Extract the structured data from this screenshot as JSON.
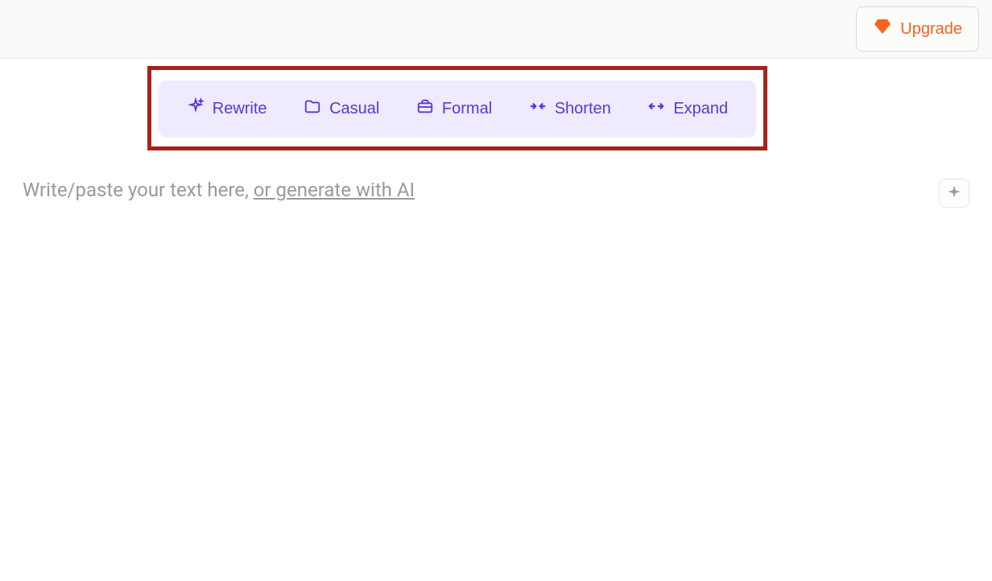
{
  "header": {
    "upgrade_label": "Upgrade"
  },
  "toolbar": {
    "items": [
      {
        "label": "Rewrite",
        "icon": "sparkle-icon"
      },
      {
        "label": "Casual",
        "icon": "folder-icon"
      },
      {
        "label": "Formal",
        "icon": "briefcase-icon"
      },
      {
        "label": "Shorten",
        "icon": "arrows-in-icon"
      },
      {
        "label": "Expand",
        "icon": "arrows-out-icon"
      }
    ]
  },
  "editor": {
    "placeholder_prefix": "Write/paste your text here, ",
    "placeholder_link": "or generate with AI"
  },
  "colors": {
    "accent_orange": "#f26522",
    "accent_purple": "#5838d6",
    "toolbar_bg": "#efeafe",
    "highlight_border": "#a8221b"
  }
}
